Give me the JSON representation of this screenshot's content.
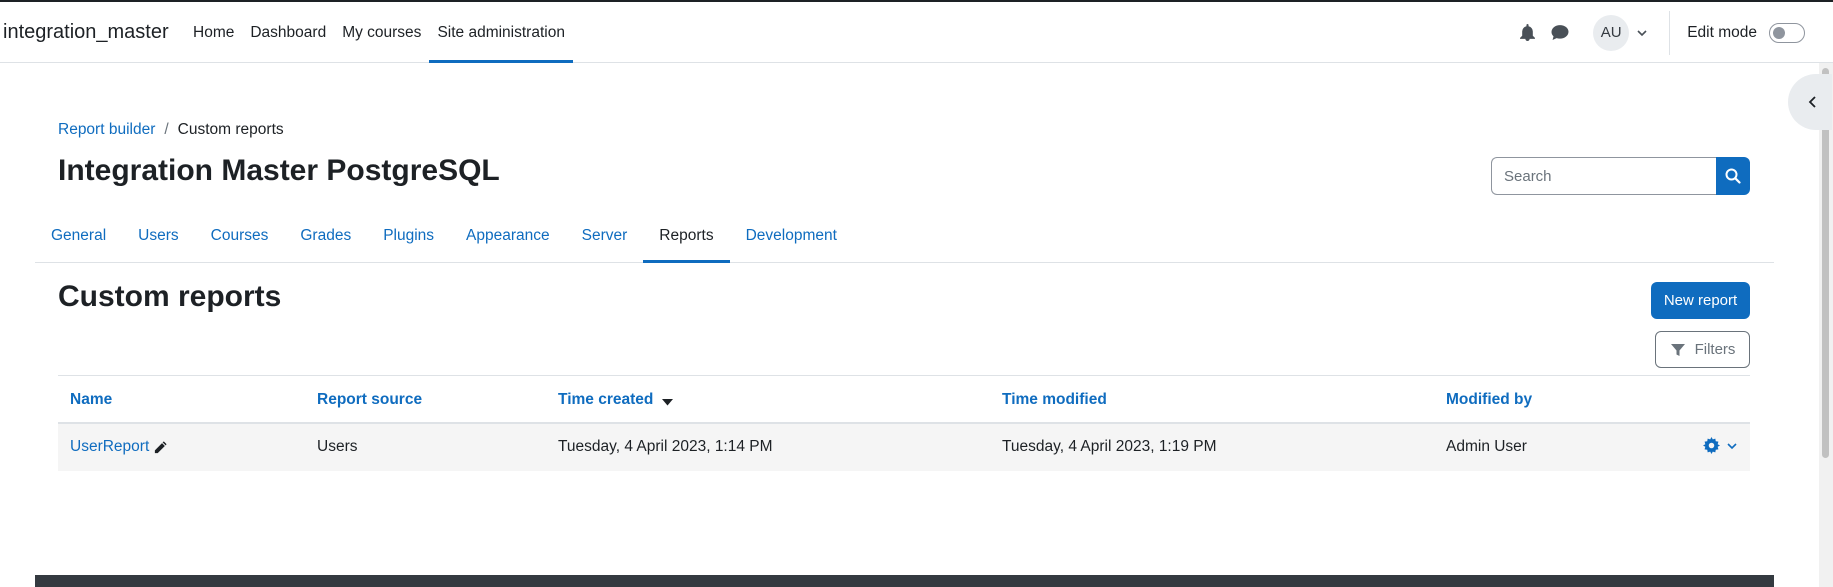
{
  "navbar": {
    "brand": "integration_master",
    "items": [
      {
        "label": "Home"
      },
      {
        "label": "Dashboard"
      },
      {
        "label": "My courses"
      },
      {
        "label": "Site administration"
      }
    ],
    "avatar_initials": "AU",
    "edit_mode_label": "Edit mode",
    "icons": [
      "bell-icon",
      "chat-icon",
      "chevron-down-icon"
    ]
  },
  "breadcrumb": {
    "items": [
      {
        "label": "Report builder"
      },
      {
        "label": "Custom reports"
      }
    ],
    "separator": "/"
  },
  "header": {
    "title": "Integration Master PostgreSQL",
    "search_placeholder": "Search"
  },
  "secondary_nav": {
    "tabs": [
      {
        "label": "General"
      },
      {
        "label": "Users"
      },
      {
        "label": "Courses"
      },
      {
        "label": "Grades"
      },
      {
        "label": "Plugins"
      },
      {
        "label": "Appearance"
      },
      {
        "label": "Server"
      },
      {
        "label": "Reports"
      },
      {
        "label": "Development"
      }
    ],
    "active": "Reports"
  },
  "main": {
    "title": "Custom reports",
    "new_report_label": "New report",
    "filters_label": "Filters"
  },
  "table": {
    "headers": [
      "Name",
      "Report source",
      "Time created",
      "Time modified",
      "Modified by"
    ],
    "sorted_column": "Time created",
    "rows": [
      {
        "name": "UserReport",
        "source": "Users",
        "created": "Tuesday, 4 April 2023, 1:14 PM",
        "modified": "Tuesday, 4 April 2023, 1:19 PM",
        "modified_by": "Admin User"
      }
    ]
  },
  "colors": {
    "primary": "#0f6cbf",
    "text": "#1d2125",
    "muted": "#6a737b",
    "footer": "#343a40"
  }
}
